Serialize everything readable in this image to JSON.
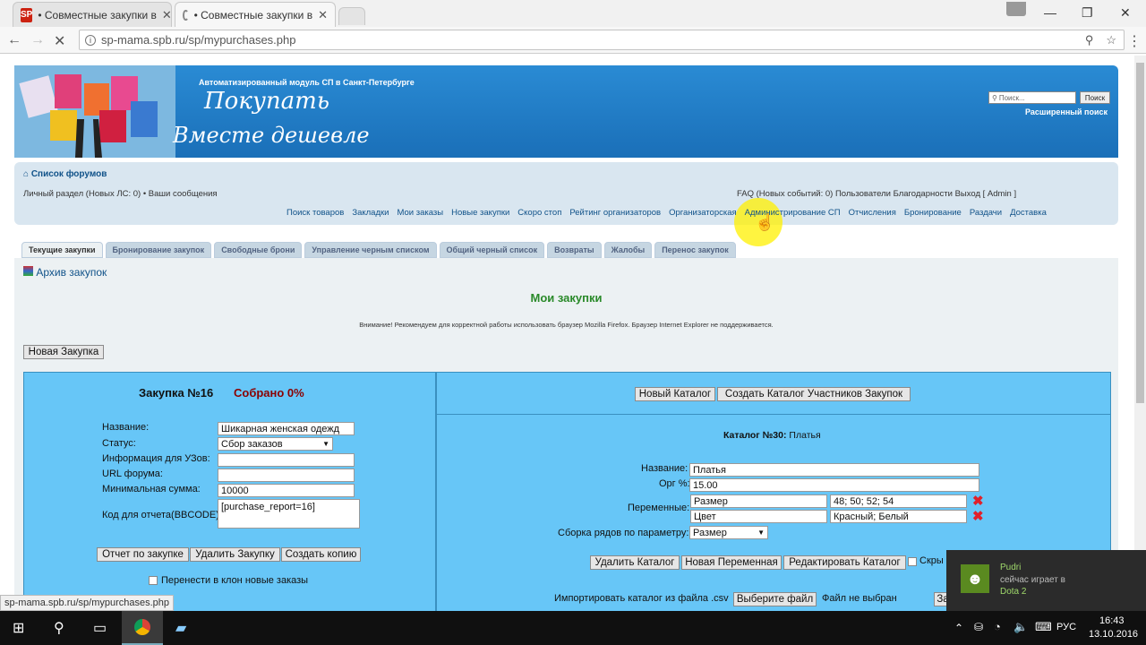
{
  "browser": {
    "tabs": [
      {
        "label": "• Совместные закупки в"
      },
      {
        "label": "• Совместные закупки в"
      }
    ],
    "url": "sp-mama.spb.ru/sp/mypurchases.php",
    "favicon_text": "SP"
  },
  "header": {
    "tagline": "Автоматизированный модуль СП в Санкт-Петербурге",
    "logo_line1": "Покупать",
    "logo_line2": "Вместе дешевле",
    "search_placeholder": "Поиск...",
    "search_button": "Поиск",
    "advanced_search": "Расширенный поиск"
  },
  "nav": {
    "forum_list": "Список форумов",
    "personal": "Личный раздел (Новых ЛС: 0) • Ваши сообщения",
    "right": "FAQ (Новых событий: 0) Пользователи Благодарности Выход [ Admin ]",
    "links": [
      "Поиск товаров",
      "Закладки",
      "Мои заказы",
      "Новые закупки",
      "Скоро стоп",
      "Рейтинг организаторов",
      "Организаторская",
      "Администрирование СП",
      "Отчисления",
      "Бронирование",
      "Раздачи",
      "Доставка"
    ]
  },
  "tabs": [
    "Текущие закупки",
    "Бронирование закупок",
    "Свободные брони",
    "Управление черным списком",
    "Общий черный список",
    "Возвраты",
    "Жалобы",
    "Перенос закупок"
  ],
  "page": {
    "archive": "Архив закупок",
    "title": "Мои закупки",
    "warning": "Внимание! Рекомендуем для корректной работы использовать браузер Mozilla Firefox. Браузер Internet Explorer не поддерживается.",
    "new_purchase": "Новая Закупка"
  },
  "purchase": {
    "heading": "Закупка №16",
    "collected": "Собрано 0%",
    "fields": [
      {
        "label": "Название:",
        "value": "Шикарная женская одежд"
      },
      {
        "label": "Статус:",
        "value": "Сбор заказов"
      },
      {
        "label": "Информация для УЗов:",
        "value": ""
      },
      {
        "label": "URL форума:",
        "value": ""
      },
      {
        "label": "Минимальная сумма:",
        "value": "10000"
      },
      {
        "label": "Код для отчета(BBCODE):",
        "value": "[purchase_report=16]"
      }
    ],
    "buttons": [
      "Отчет по закупке",
      "Удалить Закупку",
      "Создать копию"
    ],
    "clone_checkbox": "Перенести в клон новые заказы"
  },
  "catalog": {
    "btn_new": "Новый Каталог",
    "btn_create": "Создать Каталог Участников Закупок",
    "heading_bold": "Каталог №30:",
    "heading_name": "Платья",
    "name_label": "Название:",
    "name_value": "Платья",
    "org_label": "Орг %:",
    "org_value": "15.00",
    "vars_label": "Переменные:",
    "vars": [
      {
        "name": "Размер",
        "values": "48; 50; 52; 54"
      },
      {
        "name": "Цвет",
        "values": "Красный; Белый"
      }
    ],
    "rows_label": "Сборка рядов по параметру:",
    "rows_value": "Размер",
    "buttons": [
      "Удалить Каталог",
      "Новая Переменная",
      "Редактировать Каталог"
    ],
    "hide_label": "Скры",
    "import_label": "Импортировать каталог из файла .csv",
    "choose_file": "Выберите файл",
    "no_file": "Файл не выбран",
    "cut_btn": "За"
  },
  "statusbar": "sp-mama.spb.ru/sp/mypurchases.php",
  "notification": {
    "name": "Pudri",
    "line1": "сейчас играет в",
    "line2": "Dota 2"
  },
  "taskbar": {
    "lang": "РУС",
    "time": "16:43",
    "date": "13.10.2016"
  },
  "colors": {
    "header": "#1a7cc6",
    "panel": "#67c6f7",
    "collected": "#8b0000",
    "title": "#2a8a2a"
  }
}
